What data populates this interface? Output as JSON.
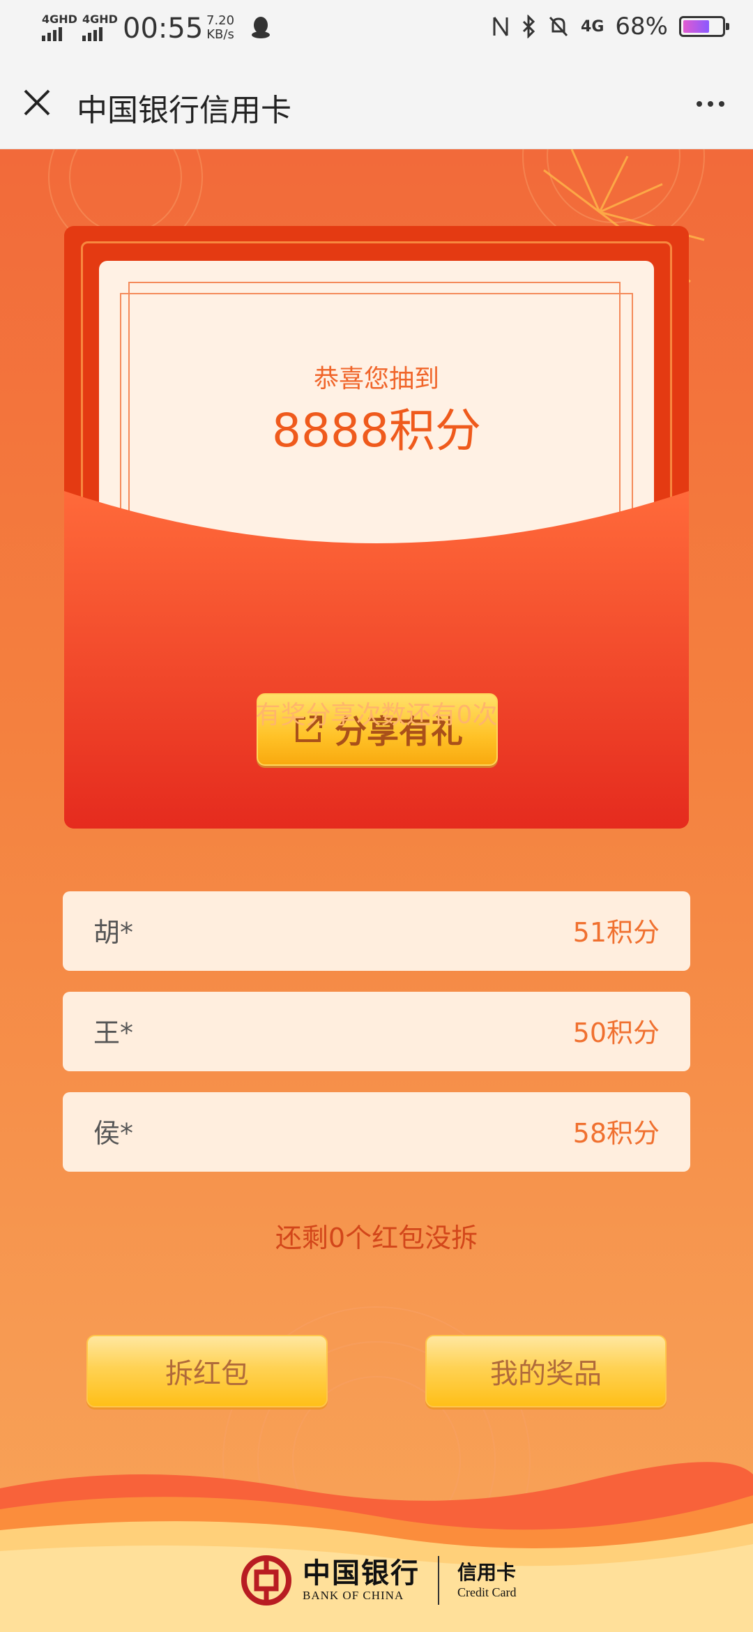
{
  "status_bar": {
    "sim1_label": "4GHD",
    "sim2_label": "4GHD",
    "time": "00:55",
    "speed_value": "7.20",
    "speed_unit": "KB/s",
    "network_label": "4G",
    "battery_percent": "68%",
    "battery_level": 0.68,
    "icons": [
      "nfc-icon",
      "bluetooth-icon",
      "mute-bell-icon",
      "qq-penguin-icon"
    ]
  },
  "title_bar": {
    "title": "中国银行信用卡"
  },
  "red_packet": {
    "congrats_text": "恭喜您抽到",
    "prize_text": "8888积分",
    "share_button_label": "分享有礼",
    "share_note": "有奖分享次数还有0次"
  },
  "winners": [
    {
      "name": "胡*",
      "points": "51积分"
    },
    {
      "name": "王*",
      "points": "50积分"
    },
    {
      "name": "侯*",
      "points": "58积分"
    }
  ],
  "remaining_text": "还剩0个红包没拆",
  "buttons": {
    "open_packet": "拆红包",
    "my_prizes": "我的奖品"
  },
  "footer": {
    "bank_name_cn": "中国银行",
    "bank_name_en": "BANK OF CHINA",
    "card_cn": "信用卡",
    "card_en": "Credit Card"
  },
  "colors": {
    "accent_orange": "#f0652a",
    "packet_red": "#e43a12",
    "button_gold": "#ffc227"
  }
}
